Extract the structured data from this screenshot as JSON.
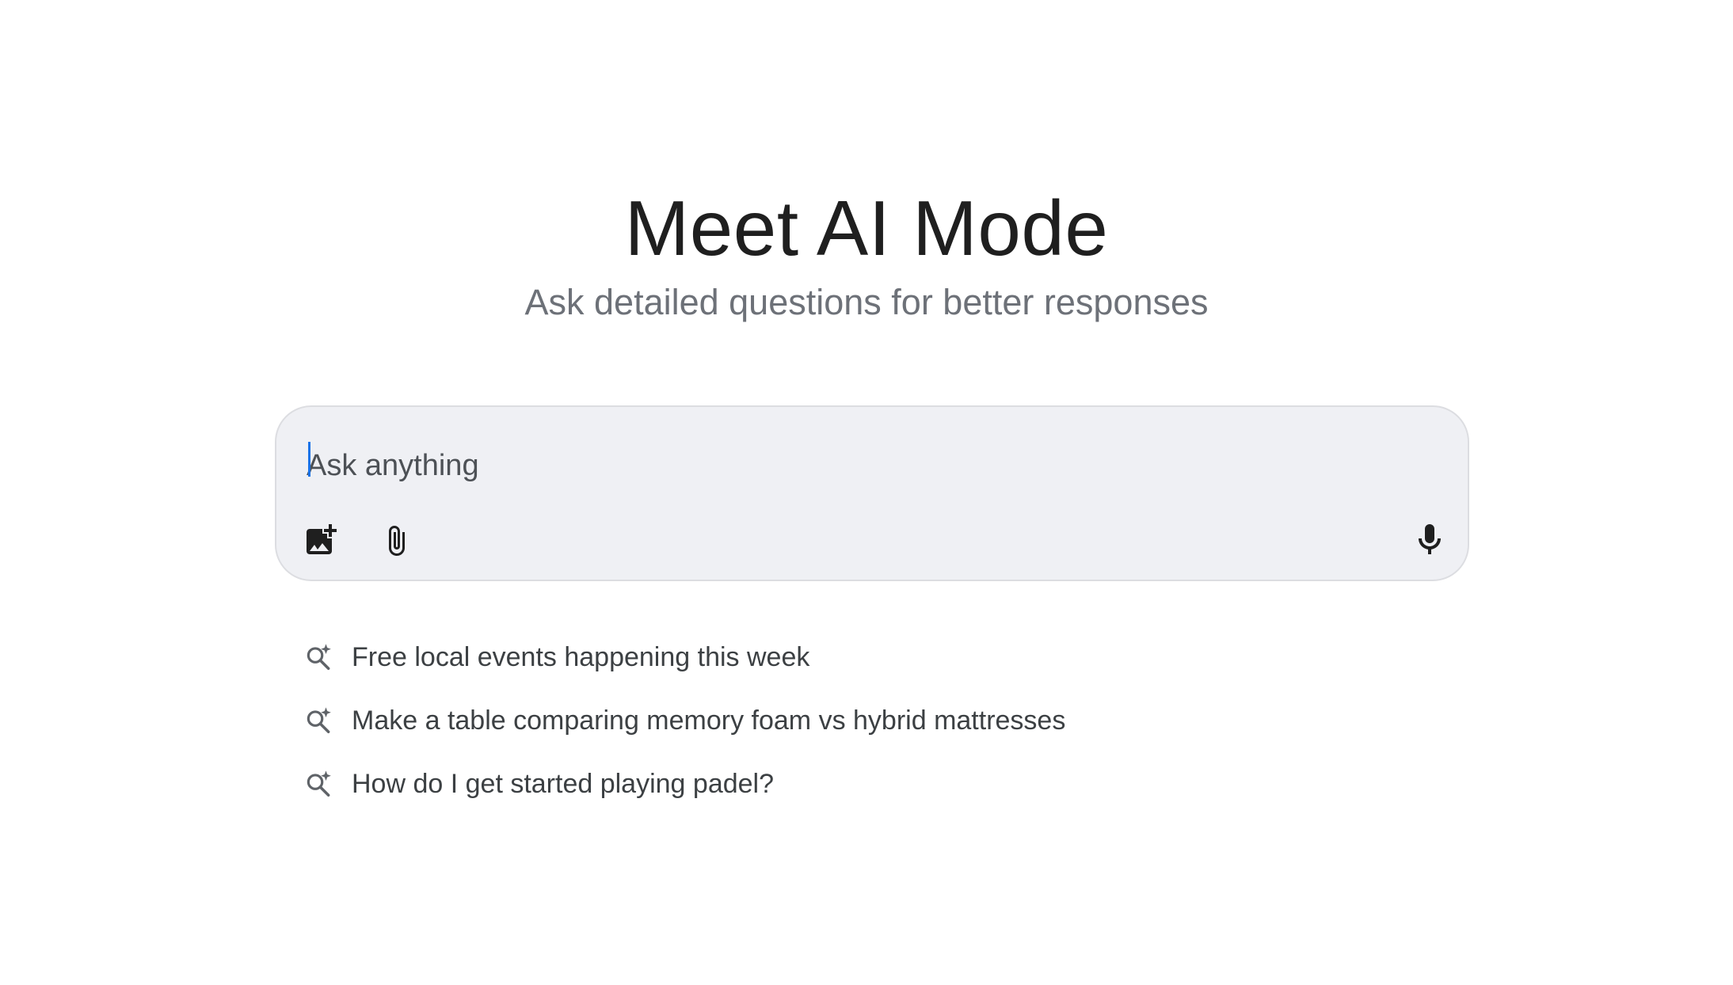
{
  "hero": {
    "title": "Meet AI Mode",
    "subtitle": "Ask detailed questions for better responses"
  },
  "search": {
    "placeholder": "Ask anything",
    "value": ""
  },
  "toolbar": {
    "image_icon": "add-image-icon",
    "attach_icon": "paperclip-icon",
    "mic_icon": "microphone-icon"
  },
  "suggestions": [
    {
      "icon": "sparkle-search-icon",
      "text": "Free local events happening this week"
    },
    {
      "icon": "sparkle-search-icon",
      "text": "Make a table comparing memory foam vs hybrid mattresses"
    },
    {
      "icon": "sparkle-search-icon",
      "text": "How do I get started playing padel?"
    }
  ],
  "colors": {
    "background": "#ffffff",
    "search_box": "#eff0f4",
    "search_border": "#dcdde1",
    "caret": "#1a73e8",
    "title": "#1f1f1f",
    "subtitle": "#6d7178",
    "suggestion_text": "#3c4043"
  }
}
